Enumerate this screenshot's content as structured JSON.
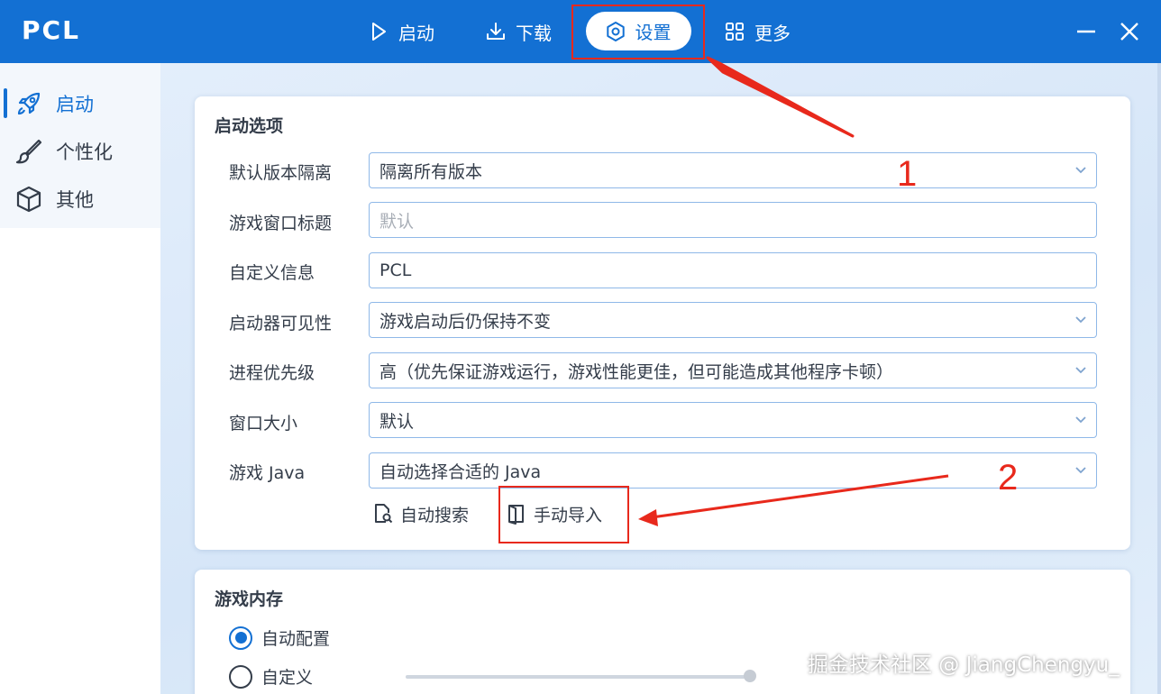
{
  "app": {
    "title": "PCL"
  },
  "nav": {
    "launch": "启动",
    "download": "下载",
    "settings": "设置",
    "more": "更多"
  },
  "sidebar": {
    "items": [
      {
        "label": "启动",
        "icon": "rocket-icon",
        "active": true
      },
      {
        "label": "个性化",
        "icon": "brush-icon",
        "active": false
      },
      {
        "label": "其他",
        "icon": "box-icon",
        "active": false
      }
    ]
  },
  "launch_options": {
    "title": "启动选项",
    "rows": [
      {
        "label": "默认版本隔离",
        "value": "隔离所有版本",
        "type": "select"
      },
      {
        "label": "游戏窗口标题",
        "placeholder": "默认",
        "value": "",
        "type": "input"
      },
      {
        "label": "自定义信息",
        "value": "PCL",
        "type": "input"
      },
      {
        "label": "启动器可见性",
        "value": "游戏启动后仍保持不变",
        "type": "select"
      },
      {
        "label": "进程优先级",
        "value": "高（优先保证游戏运行，游戏性能更佳，但可能造成其他程序卡顿）",
        "type": "select"
      },
      {
        "label": "窗口大小",
        "value": "默认",
        "type": "select"
      },
      {
        "label": "游戏 Java",
        "value": "自动选择合适的 Java",
        "type": "select"
      }
    ],
    "auto_search": "自动搜索",
    "manual_import": "手动导入"
  },
  "memory": {
    "title": "游戏内存",
    "options": [
      {
        "label": "自动配置",
        "checked": true
      },
      {
        "label": "自定义",
        "checked": false
      }
    ]
  },
  "annotations": {
    "one": "1",
    "two": "2"
  },
  "watermark": "掘金技术社区 @ JiangChengyu_",
  "colors": {
    "accent": "#1370d3",
    "annotation": "#e8291c"
  }
}
